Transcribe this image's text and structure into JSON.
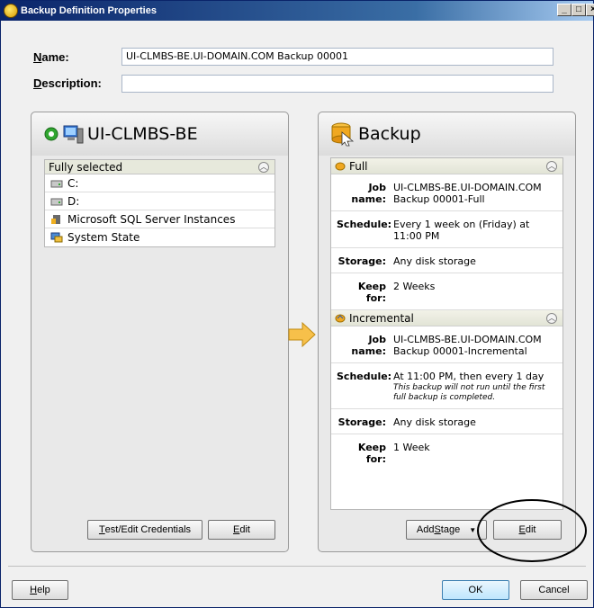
{
  "window": {
    "title": "Backup Definition Properties",
    "controls": [
      "_",
      "□",
      "×"
    ]
  },
  "form": {
    "name_label_u": "N",
    "name_label_rest": "ame:",
    "name_value": "UI-CLMBS-BE.UI-DOMAIN.COM Backup 00001",
    "description_label_u": "D",
    "description_label_rest": "escription:",
    "description_value": ""
  },
  "source_panel": {
    "title": "UI-CLMBS-BE",
    "list_header": "Fully selected",
    "items": [
      {
        "label": "C:",
        "icon": "drive-icon"
      },
      {
        "label": "D:",
        "icon": "drive-icon"
      },
      {
        "label": "Microsoft SQL Server Instances",
        "icon": "sql-server-icon"
      },
      {
        "label": "System State",
        "icon": "system-state-icon"
      }
    ],
    "test_edit_button_u": "T",
    "test_edit_button_rest": "est/Edit Credentials",
    "edit_button_pre": "",
    "edit_button_u": "E",
    "edit_button_rest": "dit"
  },
  "backup_panel": {
    "title": "Backup",
    "stages": [
      {
        "name": "Full",
        "job_name_key": "Job name:",
        "job_name_value": "UI-CLMBS-BE.UI-DOMAIN.COM Backup 00001-Full",
        "schedule_key": "Schedule:",
        "schedule_value": "Every 1 week on (Friday) at 11:00 PM",
        "schedule_note": "",
        "storage_key": "Storage:",
        "storage_value": "Any disk storage",
        "keep_key": "Keep for:",
        "keep_value": "2 Weeks"
      },
      {
        "name": "Incremental",
        "job_name_key": "Job name:",
        "job_name_value": "UI-CLMBS-BE.UI-DOMAIN.COM Backup 00001-Incremental",
        "schedule_key": "Schedule:",
        "schedule_value": "At 11:00 PM, then every 1 day",
        "schedule_note": "This backup will not run until the first full backup is completed.",
        "storage_key": "Storage:",
        "storage_value": "Any disk storage",
        "keep_key": "Keep for:",
        "keep_value": "1 Week"
      }
    ],
    "add_stage_pre": "Add ",
    "add_stage_u": "S",
    "add_stage_rest": "tage",
    "edit_u": "E",
    "edit_rest": "dit"
  },
  "footer": {
    "help_u": "H",
    "help_rest": "elp",
    "ok": "OK",
    "cancel": "Cancel"
  },
  "colors": {
    "title_bar": "#0a246a",
    "panel_bg": "#e9e9e9",
    "arrow": "#f7c04a",
    "annotation_circle": "#000000"
  }
}
